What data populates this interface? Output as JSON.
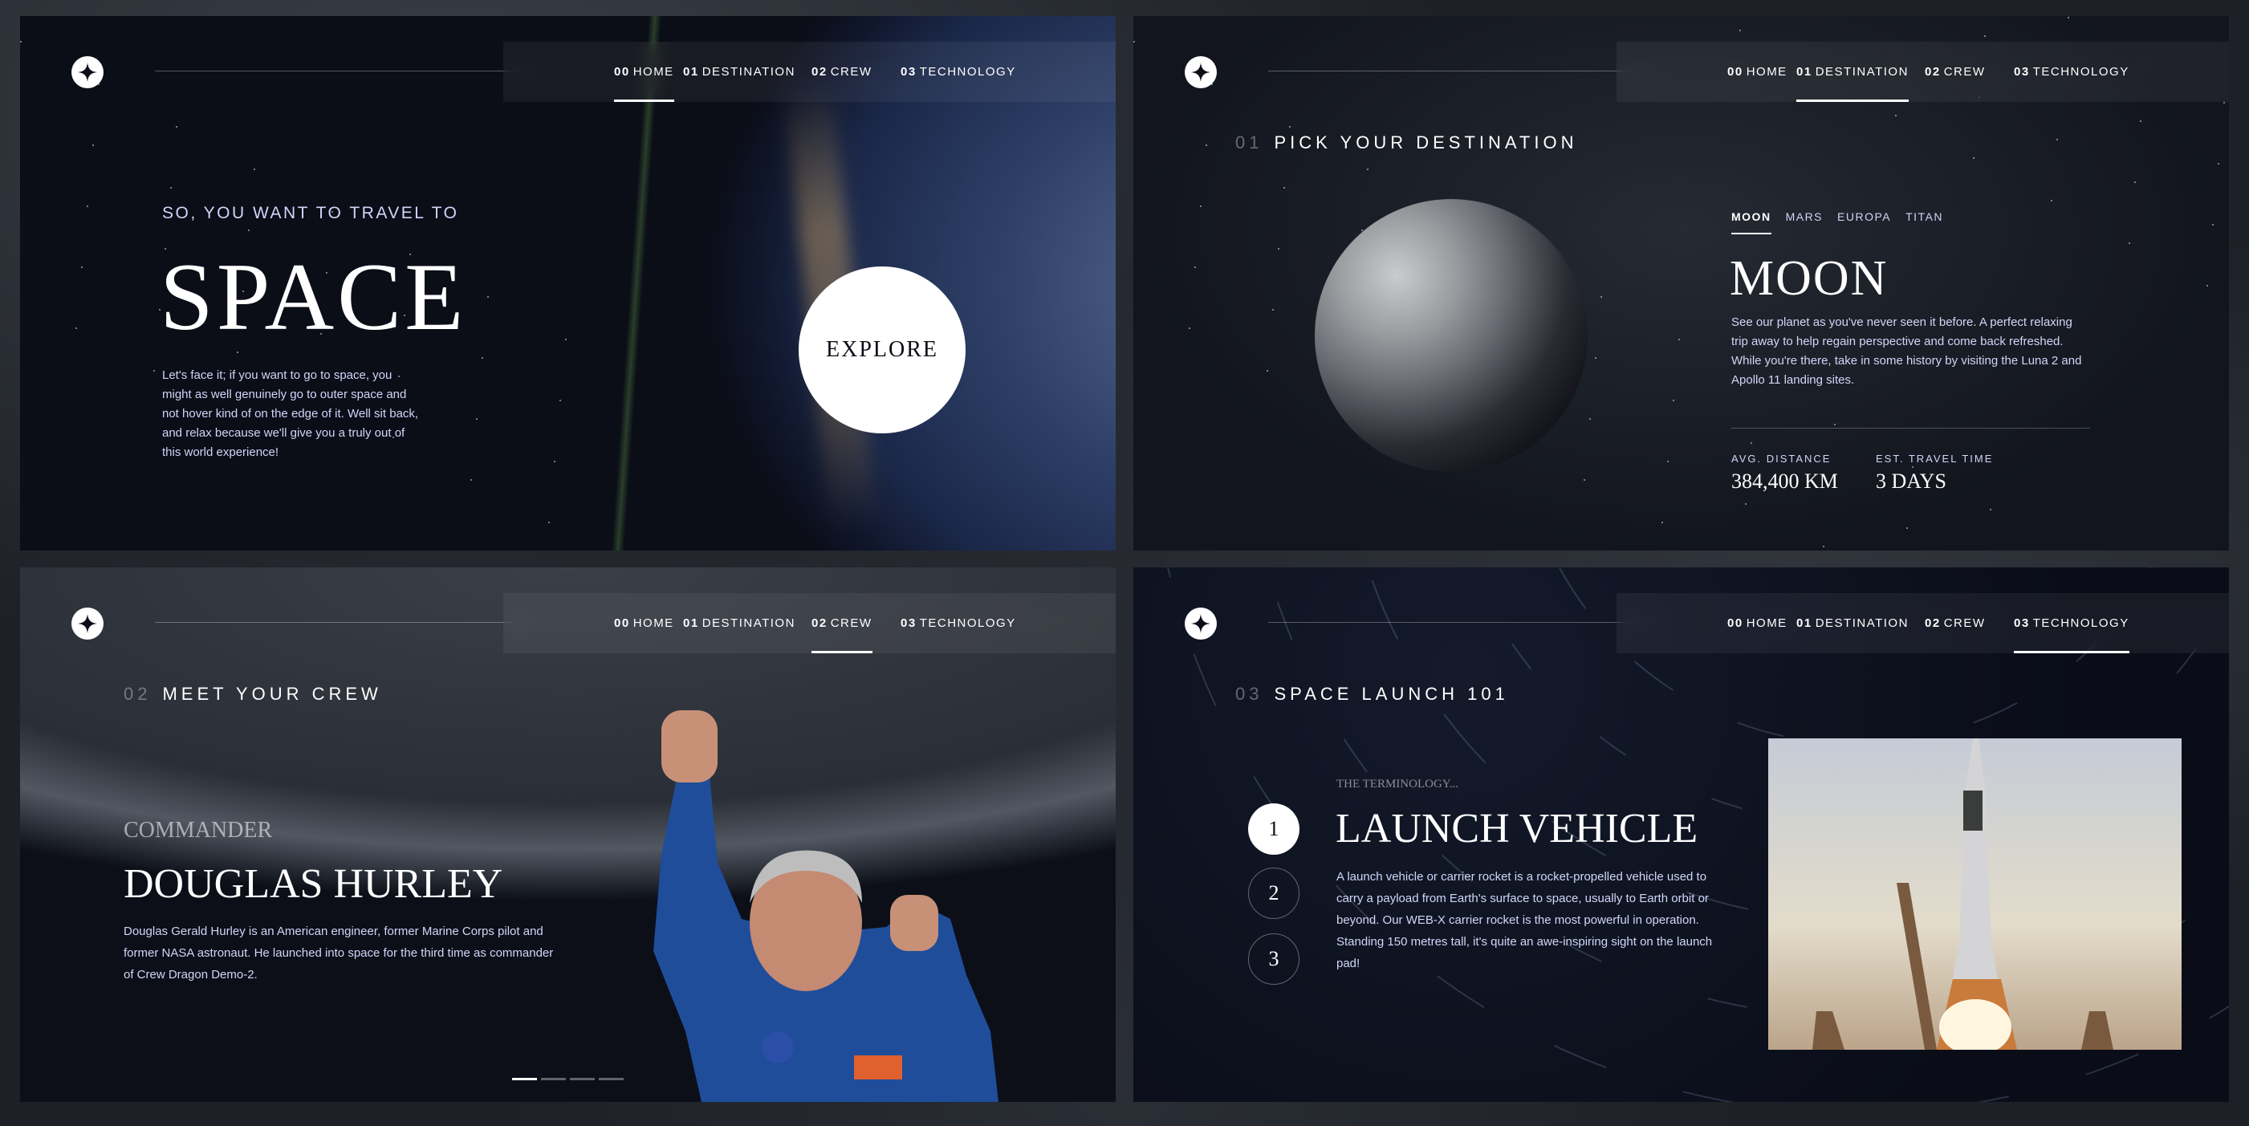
{
  "nav": {
    "items": [
      {
        "num": "00",
        "label": "HOME"
      },
      {
        "num": "01",
        "label": "DESTINATION"
      },
      {
        "num": "02",
        "label": "CREW"
      },
      {
        "num": "03",
        "label": "TECHNOLOGY"
      }
    ]
  },
  "home": {
    "eyebrow": "SO, YOU WANT TO TRAVEL TO",
    "title": "SPACE",
    "body": "Let's face it; if you want to go to space, you might as well genuinely go to outer space and not hover kind of on the edge of it. Well sit back, and relax because we'll give you a truly out of this world experience!",
    "explore": "EXPLORE",
    "active_nav": 0
  },
  "destination": {
    "heading_num": "01",
    "heading": "PICK YOUR DESTINATION",
    "tabs": [
      "MOON",
      "MARS",
      "EUROPA",
      "TITAN"
    ],
    "active_tab": 0,
    "name": "MOON",
    "body": "See our planet as you've never seen it before. A perfect relaxing trip away to help regain perspective and come back refreshed. While you're there, take in some history by visiting the Luna 2 and Apollo 11 landing sites.",
    "stats": [
      {
        "label": "AVG. DISTANCE",
        "value": "384,400 KM"
      },
      {
        "label": "EST. TRAVEL TIME",
        "value": "3 DAYS"
      }
    ],
    "active_nav": 1
  },
  "crew": {
    "heading_num": "02",
    "heading": "MEET YOUR CREW",
    "role": "COMMANDER",
    "name": "DOUGLAS HURLEY",
    "body": "Douglas Gerald Hurley is an American engineer, former Marine Corps pilot and former NASA astronaut. He launched into space for the third time as commander of Crew Dragon Demo-2.",
    "slides": 4,
    "active_slide": 0,
    "active_nav": 2
  },
  "technology": {
    "heading_num": "03",
    "heading": "SPACE LAUNCH 101",
    "eyebrow": "THE TERMINOLOGY...",
    "steps": [
      "1",
      "2",
      "3"
    ],
    "active_step": 0,
    "title": "LAUNCH VEHICLE",
    "body": "A launch vehicle or carrier rocket is a rocket-propelled vehicle used to carry a payload from Earth's surface to space, usually to Earth orbit or beyond. Our WEB-X carrier rocket is the most powerful in operation. Standing 150 metres tall, it's quite an awe-inspiring sight on the launch pad!",
    "active_nav": 3
  }
}
